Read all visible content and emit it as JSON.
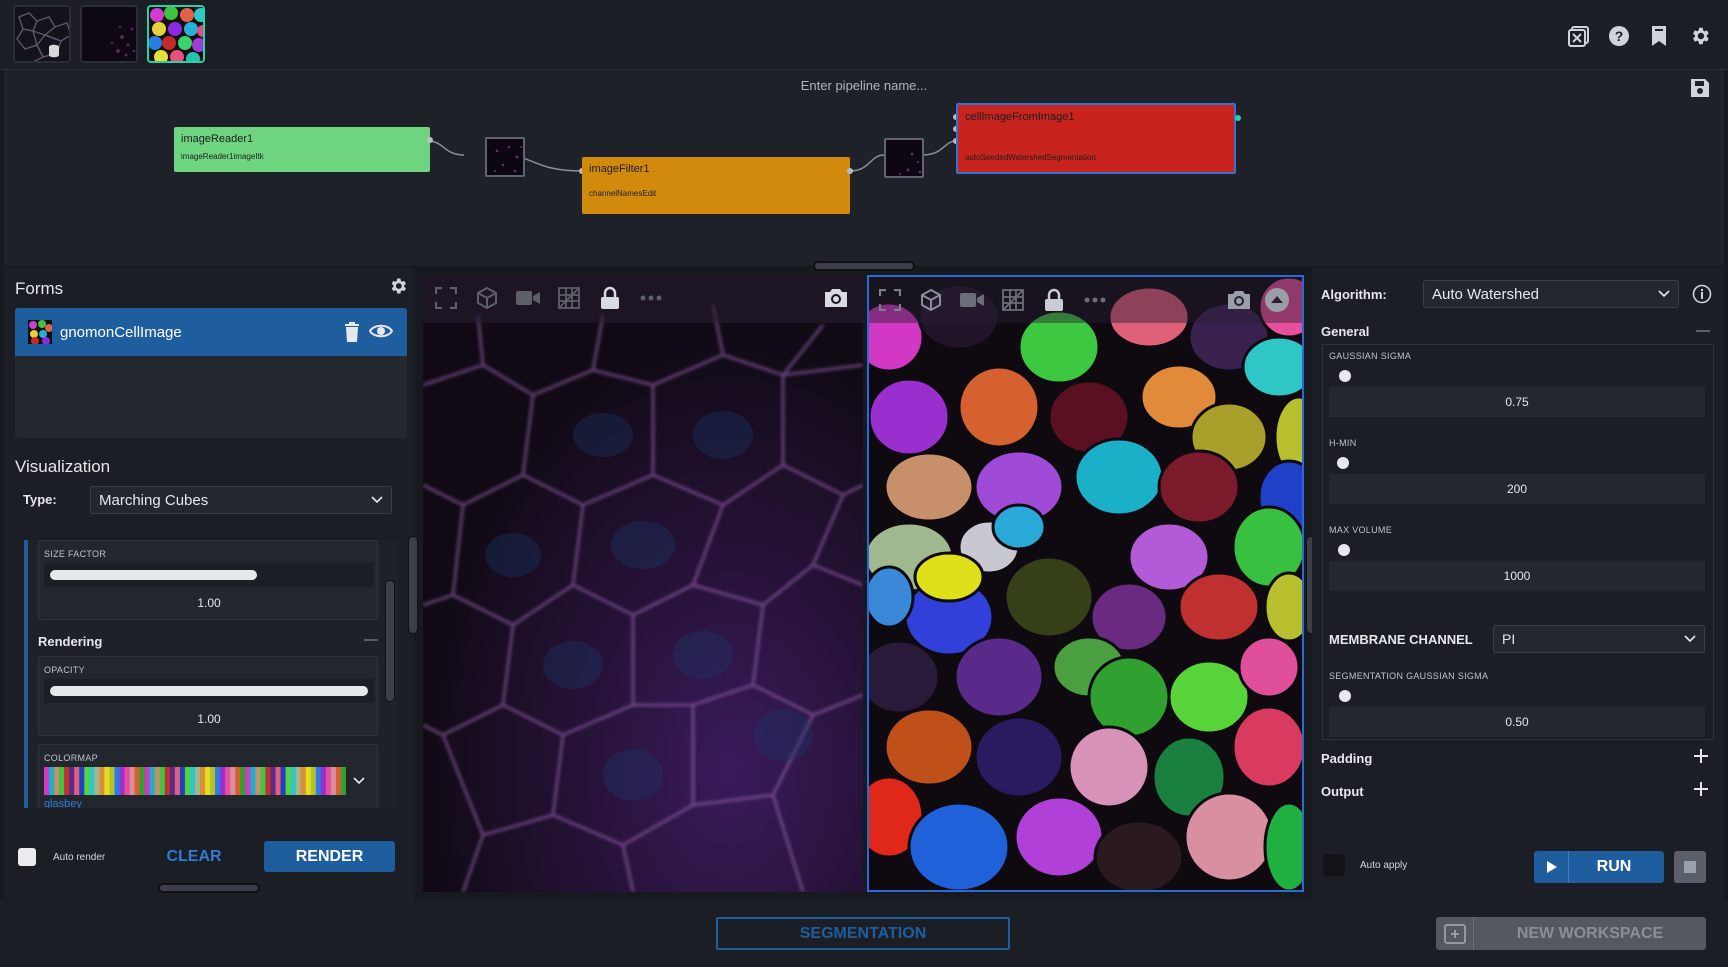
{
  "app": {
    "thumbnails": [
      {
        "name": "dataset-thumbnail",
        "active": false
      },
      {
        "name": "raw-image-thumbnail",
        "active": false
      },
      {
        "name": "segmentation-thumbnail",
        "active": true
      }
    ],
    "top_icons": [
      "close-workspace-icon",
      "help-icon",
      "bookmark-icon",
      "settings-icon"
    ]
  },
  "pipeline": {
    "name_placeholder": "Enter pipeline name...",
    "nodes": [
      {
        "name": "imageReader1",
        "output": "imageReader1imageItk",
        "color": "#6fd47f"
      },
      {
        "name": "imageFilter1",
        "output": "channelNamesEdit",
        "color": "#d18a0c"
      },
      {
        "name": "cellImageFromImage1",
        "output": "autoSeededWatershedSegmentation",
        "color": "#c8231d"
      }
    ]
  },
  "forms": {
    "title": "Forms",
    "item_label": "gnomonCellImage"
  },
  "visualization": {
    "title": "Visualization",
    "type_label": "Type:",
    "type_value": "Marching Cubes",
    "size_factor": {
      "caption": "SIZE FACTOR",
      "value": "1.00",
      "fraction": 0.65
    },
    "rendering_title": "Rendering",
    "opacity": {
      "caption": "OPACITY",
      "value": "1.00",
      "fraction": 1.0
    },
    "colormap": {
      "caption": "COLORMAP",
      "value": "glasbey"
    }
  },
  "actions": {
    "auto_render": "Auto render",
    "clear": "CLEAR",
    "render": "RENDER"
  },
  "algorithm": {
    "label": "Algorithm:",
    "value": "Auto Watershed",
    "general": "General",
    "params": [
      {
        "caption": "GAUSSIAN SIGMA",
        "value": "0.75"
      },
      {
        "caption": "H-MIN",
        "value": "200"
      },
      {
        "caption": "MAX VOLUME",
        "value": "1000"
      }
    ],
    "membrane_channel_label": "MEMBRANE CHANNEL",
    "membrane_channel_value": "PI",
    "seg_sigma": {
      "caption": "SEGMENTATION GAUSSIAN SIGMA",
      "value": "0.50"
    },
    "padding": "Padding",
    "output": "Output",
    "auto_apply": "Auto apply",
    "run": "RUN"
  },
  "bottom": {
    "segmentation": "SEGMENTATION",
    "new_workspace": "NEW WORKSPACE"
  },
  "colors": {
    "accent_blue": "#1f5e9e",
    "teal": "#2ad1a6",
    "panel": "#1b1e24"
  }
}
